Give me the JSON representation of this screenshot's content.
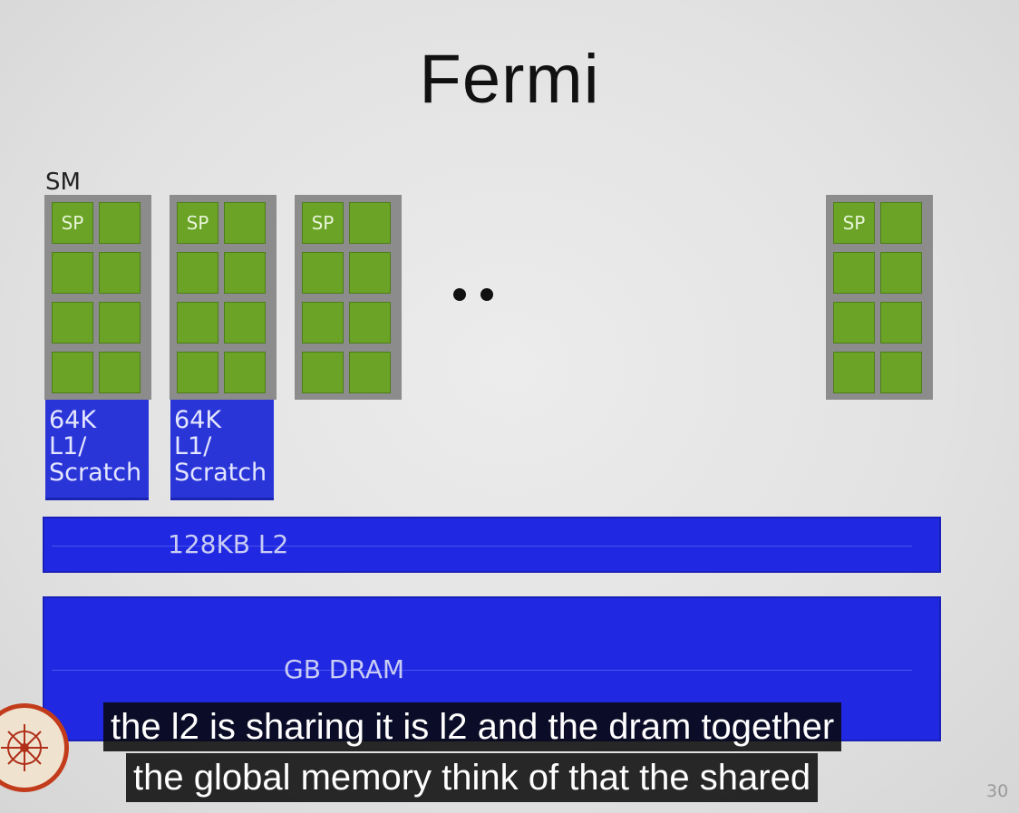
{
  "slide": {
    "title": "Fermi",
    "sm_label": "SM",
    "sp_label": "SP",
    "l1_lines": [
      "64K",
      "L1/",
      "Scratch"
    ],
    "l2_label": "128KB L2",
    "dram_label": "GB DRAM",
    "page_number": "30",
    "colors": {
      "sp_green": "#6aa326",
      "sm_gray": "#8c8c8c",
      "memory_blue": "#2028e2",
      "l1_blue": "#2a35d8"
    }
  },
  "captions": {
    "line1": "the l2 is sharing it is l2 and the dram together",
    "line2": "the global memory think of that the shared"
  },
  "icons": {
    "logo": "institute-logo-icon",
    "ellipsis": "ellipsis-dots-icon"
  }
}
